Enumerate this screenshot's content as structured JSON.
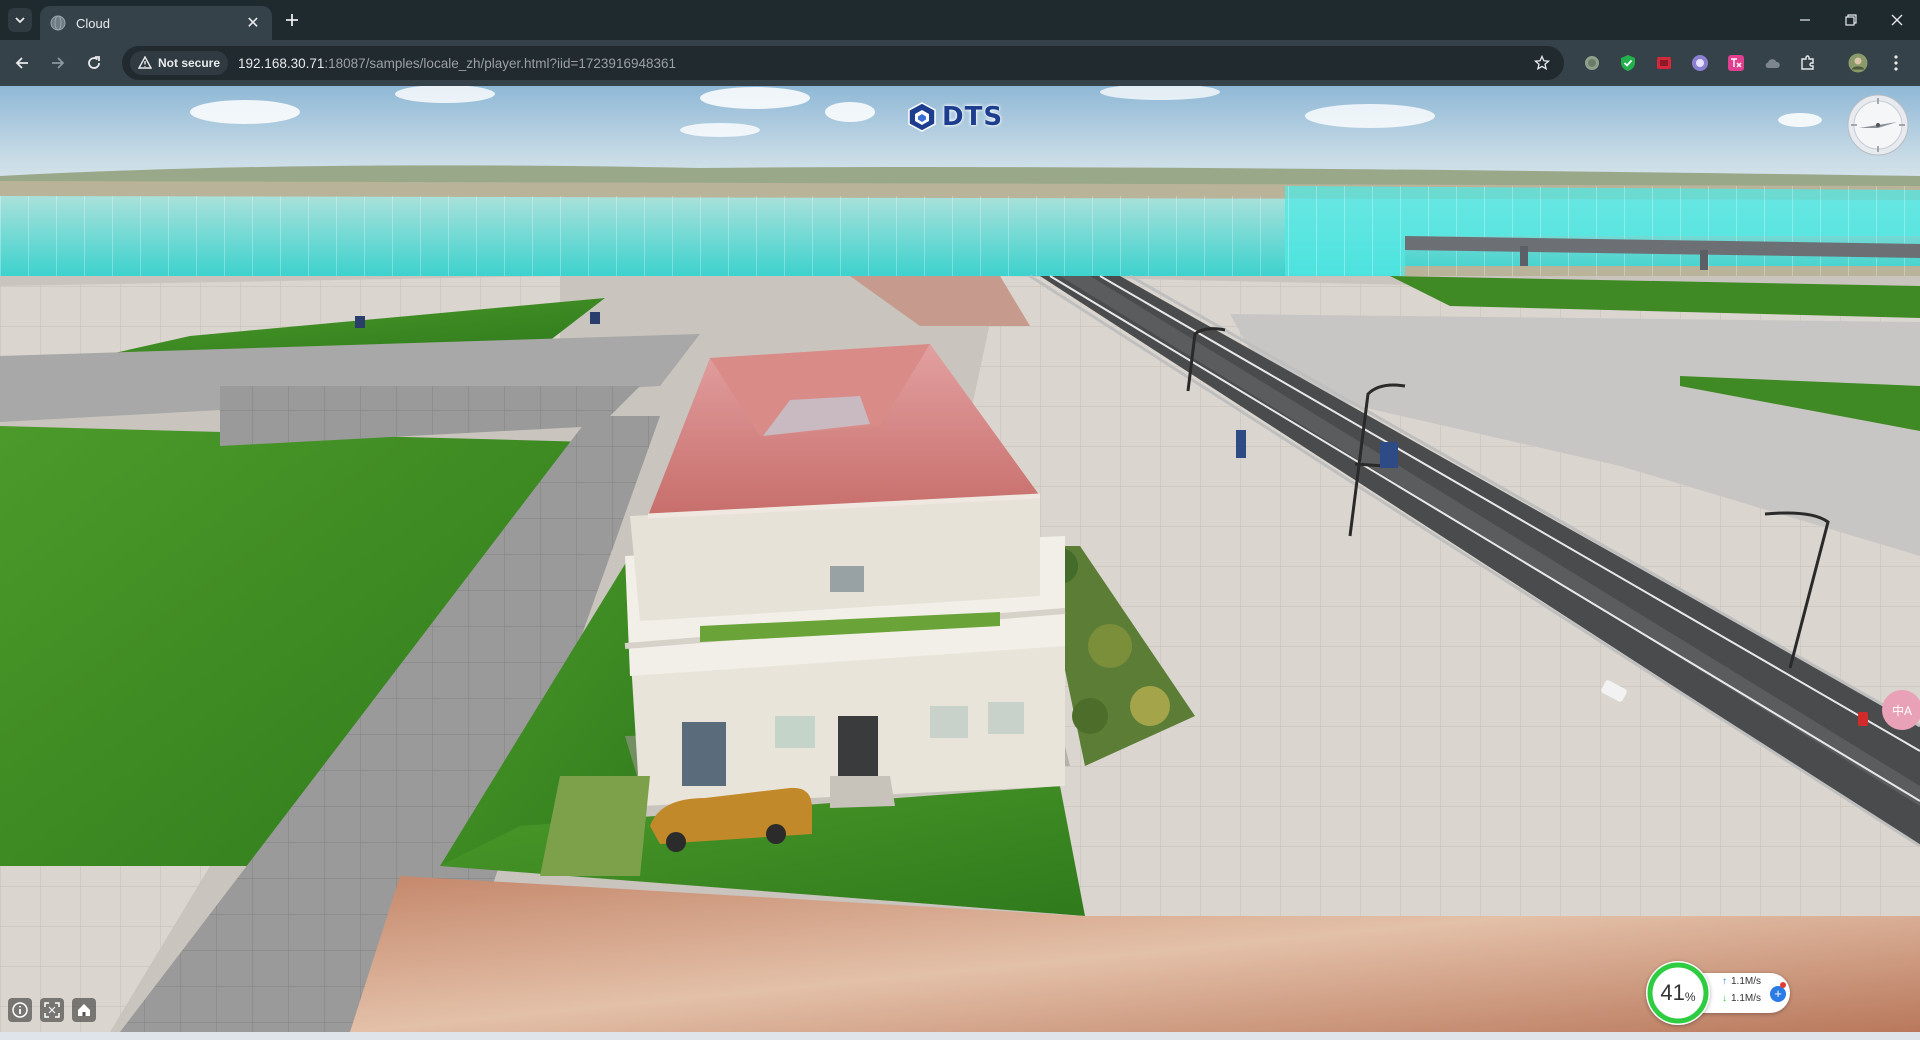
{
  "browser": {
    "tab": {
      "title": "Cloud",
      "favicon": "globe-icon",
      "close_glyph": "✕"
    },
    "new_tab_glyph": "+",
    "toolbar": {
      "security_label": "Not secure",
      "url_host": "192.168.30.71",
      "url_rest": ":18087/samples/locale_zh/player.html?iid=1723916948361"
    },
    "extensions": [
      "circle-extension-icon",
      "shield-extension-icon",
      "red-extension-icon",
      "purple-extension-icon",
      "translate-extension-icon",
      "cloud-extension-icon",
      "puzzle-icon",
      "profile-avatar"
    ],
    "window_controls": [
      "minimize-icon",
      "restore-icon",
      "close-icon"
    ]
  },
  "viewer": {
    "logo_text": "DTS",
    "side_button_label": "中A",
    "network": {
      "percent": "41",
      "percent_unit": "%",
      "upload": "1.1M/s",
      "download": "1.1M/s",
      "upload_arrow": "↑",
      "download_arrow": "↓"
    },
    "controls": [
      "info-icon",
      "fullscreen-icon",
      "home-icon"
    ]
  },
  "colors": {
    "chrome_dark": "#1f2a2f",
    "chrome_toolbar": "#35424a",
    "grass": "#3f8a24",
    "roof": "#d47a78",
    "water": "#3fd9d6",
    "ring_green": "#2ecc40"
  }
}
